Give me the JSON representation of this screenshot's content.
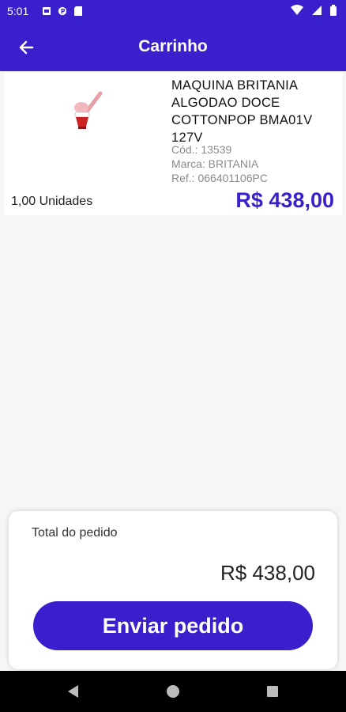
{
  "status_bar": {
    "time": "5:01"
  },
  "app_bar": {
    "title": "Carrinho"
  },
  "cart_items": [
    {
      "name": "MAQUINA BRITANIA ALGODAO DOCE COTTONPOP BMA01V 127V",
      "code": "Cód.: 13539",
      "brand": "Marca: BRITANIA",
      "ref": "Ref.: 066401106PC",
      "quantity": "1,00 Unidades",
      "price": "R$ 438,00"
    }
  ],
  "summary": {
    "total_label": "Total do pedido",
    "total_value": "R$ 438,00",
    "send_label": "Enviar pedido"
  },
  "colors": {
    "primary": "#3a1fcc",
    "background": "#f6f6f6",
    "muted_text": "#8a8a8a"
  }
}
